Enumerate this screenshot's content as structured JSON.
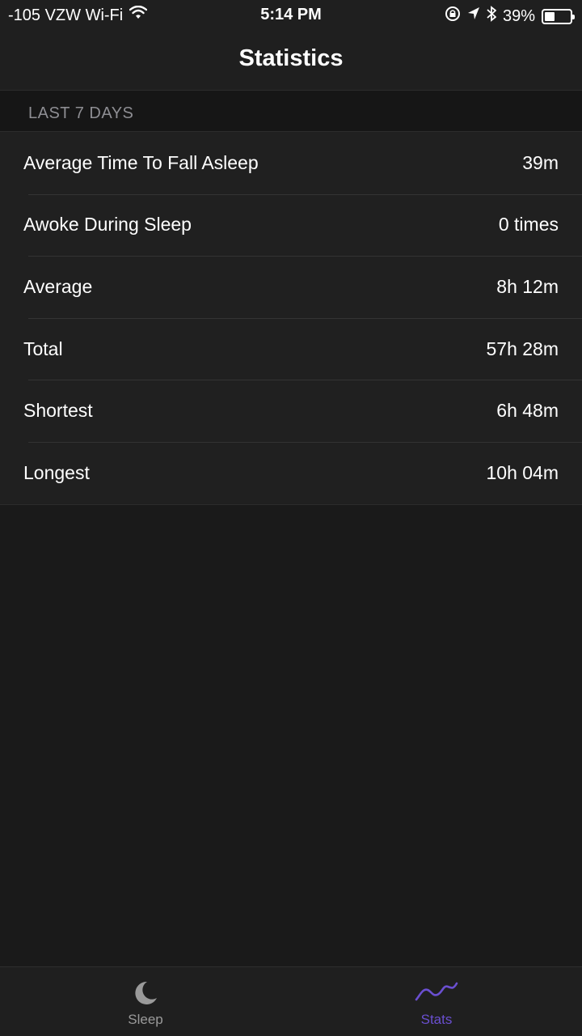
{
  "status_bar": {
    "carrier": "-105 VZW Wi-Fi",
    "time": "5:14 PM",
    "battery_percent": "39%",
    "battery_level": 0.39,
    "icons": [
      "wifi-icon",
      "rotation-lock-icon",
      "location-icon",
      "bluetooth-icon",
      "battery-icon"
    ]
  },
  "nav": {
    "title": "Statistics"
  },
  "section": {
    "header": "LAST 7 DAYS"
  },
  "stats": [
    {
      "label": "Average Time To Fall Asleep",
      "value": "39m"
    },
    {
      "label": "Awoke During Sleep",
      "value": "0 times"
    },
    {
      "label": "Average",
      "value": "8h 12m"
    },
    {
      "label": "Total",
      "value": "57h 28m"
    },
    {
      "label": "Shortest",
      "value": "6h 48m"
    },
    {
      "label": "Longest",
      "value": "10h 04m"
    }
  ],
  "tabs": [
    {
      "label": "Sleep",
      "icon": "moon-icon",
      "selected": false
    },
    {
      "label": "Stats",
      "icon": "stats-wave-icon",
      "selected": true
    }
  ],
  "colors": {
    "accent": "#6a4fd0",
    "background": "#1a1a1a",
    "row_background": "#202020",
    "inactive_tab": "#9a9a9a"
  }
}
